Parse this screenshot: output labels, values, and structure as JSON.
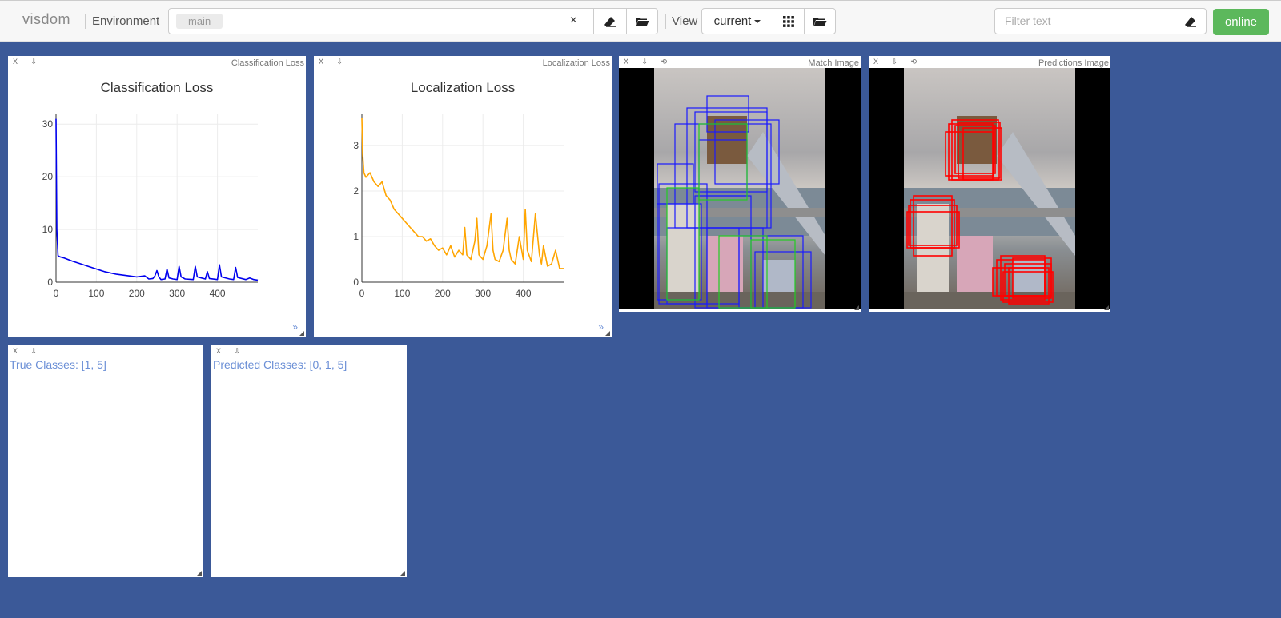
{
  "app": {
    "brand": "visdom",
    "env_label": "Environment",
    "env_chip": "main",
    "env_clear": "×",
    "view_label": "View",
    "view_value": "current",
    "filter_placeholder": "Filter text",
    "status": "online",
    "colors": {
      "background": "#3b5998",
      "online": "#5cb85c"
    }
  },
  "icons": [
    "eraser-icon",
    "folder-open-icon",
    "grid-icon",
    "folder-open-icon",
    "eraser-icon",
    "close-icon",
    "download-icon",
    "refresh-icon",
    "resize-icon"
  ],
  "panes": {
    "cls_loss": {
      "pane_title": "Classification Loss",
      "controls": "X ⇩",
      "more": "»"
    },
    "loc_loss": {
      "pane_title": "Localization Loss",
      "controls": "X ⇩",
      "more": "»"
    },
    "match_image": {
      "pane_title": "Match Image",
      "controls": "X ⇩ ⟲"
    },
    "pred_image": {
      "pane_title": "Predictions Image",
      "controls": "X ⇩ ⟲"
    },
    "true_classes": {
      "controls": "X ⇩",
      "text": "True Classes: [1, 5]"
    },
    "pred_classes": {
      "controls": "X ⇩",
      "text": "Predicted Classes: [0, 1, 5]"
    }
  },
  "chart_data": [
    {
      "type": "line",
      "title": "Classification Loss",
      "xlabel": "",
      "ylabel": "",
      "xlim": [
        0,
        500
      ],
      "ylim": [
        0,
        32
      ],
      "xticks": [
        0,
        100,
        200,
        300,
        400
      ],
      "yticks": [
        0,
        10,
        20,
        30
      ],
      "grid": true,
      "color": "#0000ee",
      "series": [
        {
          "x": [
            0,
            2,
            5,
            10,
            20,
            40,
            60,
            80,
            100,
            120,
            150,
            180,
            200,
            220,
            230,
            240,
            245,
            250,
            255,
            260,
            270,
            275,
            280,
            290,
            300,
            305,
            310,
            320,
            340,
            345,
            350,
            370,
            375,
            380,
            400,
            405,
            410,
            430,
            440,
            445,
            450,
            470,
            480,
            490,
            500
          ],
          "y": [
            31,
            10,
            5,
            4.8,
            4.6,
            4.0,
            3.5,
            3.0,
            2.5,
            2.0,
            1.5,
            1.2,
            1.0,
            1.2,
            0.6,
            0.7,
            1.2,
            2.2,
            1.0,
            0.5,
            0.6,
            2.5,
            0.8,
            0.6,
            0.5,
            3.0,
            1.0,
            0.6,
            0.5,
            3.0,
            1.0,
            0.6,
            2.0,
            0.7,
            0.5,
            3.3,
            1.0,
            0.6,
            0.5,
            2.8,
            0.9,
            0.5,
            0.8,
            0.5,
            0.4
          ]
        }
      ]
    },
    {
      "type": "line",
      "title": "Localization Loss",
      "xlabel": "",
      "ylabel": "",
      "xlim": [
        0,
        500
      ],
      "ylim": [
        0,
        3.7
      ],
      "xticks": [
        0,
        100,
        200,
        300,
        400
      ],
      "yticks": [
        0,
        1,
        2,
        3
      ],
      "grid": true,
      "color": "#ffa500",
      "series": [
        {
          "x": [
            0,
            2,
            5,
            10,
            20,
            30,
            40,
            50,
            60,
            70,
            80,
            90,
            100,
            110,
            120,
            130,
            140,
            150,
            160,
            170,
            180,
            190,
            200,
            210,
            220,
            230,
            240,
            250,
            255,
            260,
            270,
            280,
            285,
            290,
            300,
            310,
            320,
            325,
            330,
            340,
            350,
            360,
            365,
            370,
            380,
            390,
            400,
            405,
            410,
            420,
            430,
            440,
            445,
            450,
            460,
            470,
            480,
            490,
            500
          ],
          "y": [
            3.6,
            2.8,
            2.4,
            2.3,
            2.4,
            2.2,
            2.1,
            2.2,
            1.9,
            1.8,
            1.6,
            1.5,
            1.4,
            1.3,
            1.2,
            1.1,
            1.0,
            1.0,
            0.9,
            0.95,
            0.8,
            0.7,
            0.75,
            0.6,
            0.8,
            0.55,
            0.7,
            0.6,
            1.2,
            0.6,
            0.5,
            0.9,
            1.4,
            0.6,
            0.5,
            0.8,
            1.5,
            0.7,
            0.5,
            0.45,
            0.7,
            1.4,
            0.7,
            0.5,
            0.4,
            1.0,
            0.5,
            1.6,
            0.7,
            0.45,
            1.5,
            0.6,
            0.4,
            0.8,
            0.35,
            0.4,
            0.7,
            0.3,
            0.3
          ]
        }
      ]
    }
  ]
}
